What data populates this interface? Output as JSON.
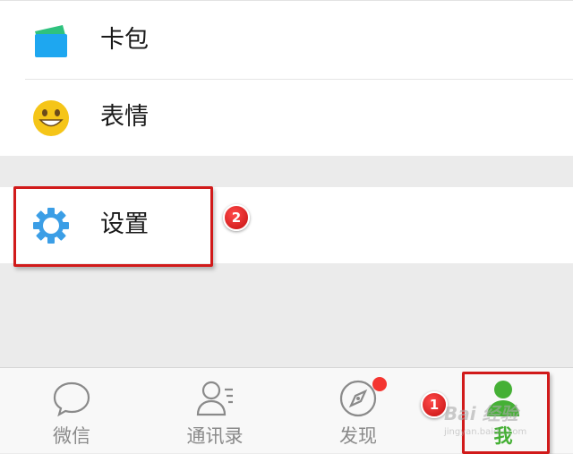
{
  "menu": {
    "items": [
      {
        "label": "卡包",
        "icon": "card-wallet-icon"
      },
      {
        "label": "表情",
        "icon": "smiley-icon"
      }
    ],
    "settings": {
      "label": "设置",
      "icon": "gear-icon"
    }
  },
  "annotations": {
    "step_one": "1",
    "step_two": "2"
  },
  "tabbar": {
    "tabs": [
      {
        "label": "微信",
        "icon": "chat-bubble-icon",
        "active": false
      },
      {
        "label": "通讯录",
        "icon": "contacts-icon",
        "active": false
      },
      {
        "label": "发现",
        "icon": "compass-icon",
        "active": false,
        "badge_dot": true
      },
      {
        "label": "我",
        "icon": "person-icon",
        "active": true
      }
    ]
  },
  "watermark": {
    "text": "Bai 经验",
    "sub": "jingyan.baidu.com"
  },
  "colors": {
    "accent_green": "#45b035",
    "annotation_red": "#d11a1a",
    "settings_blue": "#3b9ee6",
    "card_green": "#2ec27e",
    "smiley_yellow": "#f5c518",
    "badge_red": "#f43530"
  }
}
